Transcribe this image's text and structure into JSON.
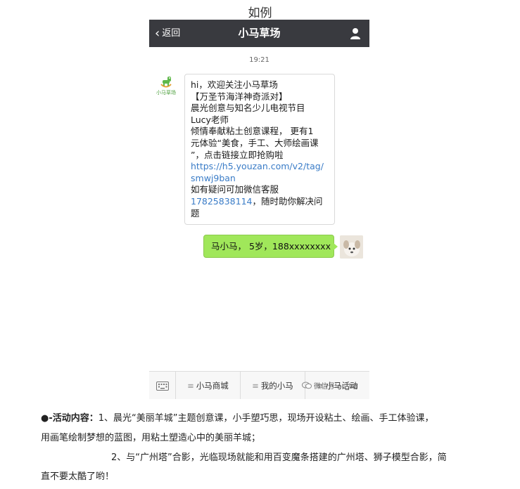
{
  "heading": "如例",
  "navbar": {
    "back_label": "返回",
    "title": "小马草场"
  },
  "chat": {
    "timestamp": "19:21",
    "bot_avatar_text": "小马草场",
    "incoming": {
      "lines": [
        "hi，欢迎关注小马草场",
        "【万圣节海洋神奇派对】",
        "晨光创意与知名少儿电视节目",
        "Lucy老师",
        "倾情奉献粘土创意课程， 更有1",
        "元体验“美食，手工、大师绘画课",
        "”，点击链接立即抢购啦"
      ],
      "link_lines": [
        "https://h5.youzan.com/v2/tag/",
        "smwj9ban"
      ],
      "after_link": "如有疑问可加微信客服",
      "phone": "17825838114",
      "phone_suffix": "，随时助你解决问",
      "last_line": "题"
    },
    "outgoing": "马小马， 5岁，188xxxxxxxx"
  },
  "menu": {
    "items": [
      "小马商城",
      "我的小马",
      "小马活动"
    ]
  },
  "watermark": "微信号 nc_lib",
  "article": {
    "bullet": "●",
    "label": "-活动内容：",
    "p1_rest": "1、晨光“美丽羊城”主题创意课，小手塑巧思，现场开设粘土、绘画、手工体验课，",
    "p1_line2": "用画笔绘制梦想的蓝图，用粘土塑造心中的美丽羊城；",
    "p2_line1": "2、与“广州塔”合影，光临现场就能和用百变魔条搭建的广州塔、狮子模型合影，简",
    "p2_line2": "直不要太酷了哟！"
  }
}
